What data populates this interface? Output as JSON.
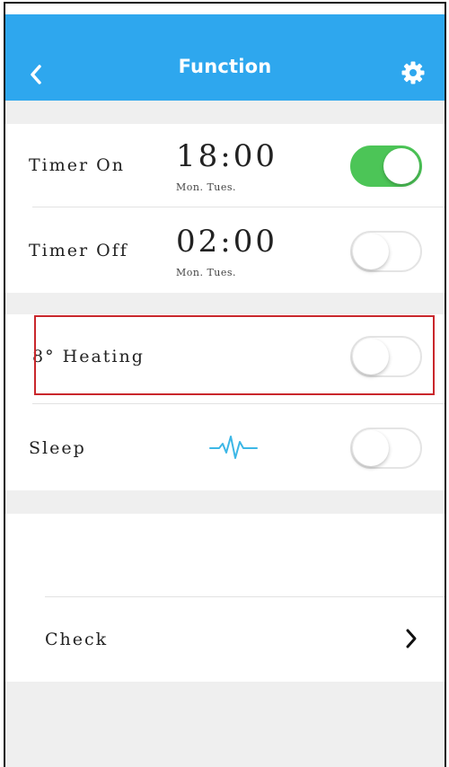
{
  "header": {
    "title": "Function",
    "back_icon": "chevron-left-icon",
    "settings_icon": "gear-icon",
    "color": "#2ea7ee"
  },
  "rows": {
    "timer_on": {
      "label": "Timer On",
      "time": "18:00",
      "days": "Mon. Tues.",
      "toggle_on": true
    },
    "timer_off": {
      "label": "Timer Off",
      "time": "02:00",
      "days": "Mon. Tues.",
      "toggle_on": false
    },
    "heating": {
      "label": "8° Heating",
      "toggle_on": false,
      "highlighted": true
    },
    "sleep": {
      "label": "Sleep",
      "icon": "sleep-wave-icon",
      "toggle_on": false
    },
    "check": {
      "label": "Check",
      "icon": "chevron-right-icon"
    }
  },
  "colors": {
    "toggle_on": "#4cc557",
    "highlight_border": "#c9272c",
    "separator_band": "#efefef"
  }
}
